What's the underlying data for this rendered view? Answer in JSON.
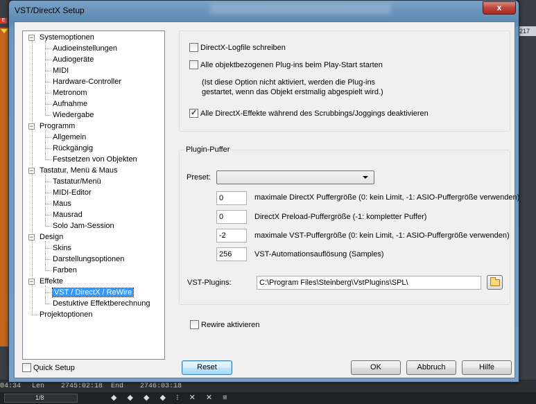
{
  "window": {
    "title": "VST/DirectX Setup",
    "close_label": "x"
  },
  "background": {
    "left_tag": "E",
    "right_ruler": "217",
    "status": {
      "pos": "04:34",
      "len_label": "Len",
      "len_value": "2745:02:18",
      "end_label": "End",
      "end_value": "2746:03:18"
    },
    "zoom": "1/8",
    "tools": "◆ ◆ ◆ ◆ ⁝ ✕ ✕ ≡"
  },
  "tree": [
    {
      "label": "Systemoptionen",
      "level": 0,
      "expander": "−"
    },
    {
      "label": "Audioeinstellungen",
      "level": 1
    },
    {
      "label": "Audiogeräte",
      "level": 1
    },
    {
      "label": "MIDI",
      "level": 1
    },
    {
      "label": "Hardware-Controller",
      "level": 1
    },
    {
      "label": "Metronom",
      "level": 1
    },
    {
      "label": "Aufnahme",
      "level": 1
    },
    {
      "label": "Wiedergabe",
      "level": 1
    },
    {
      "label": "Programm",
      "level": 0,
      "expander": "−"
    },
    {
      "label": "Allgemein",
      "level": 1
    },
    {
      "label": "Rückgängig",
      "level": 1
    },
    {
      "label": "Festsetzen von Objekten",
      "level": 1
    },
    {
      "label": "Tastatur, Menü & Maus",
      "level": 0,
      "expander": "−"
    },
    {
      "label": "Tastatur/Menü",
      "level": 1
    },
    {
      "label": "MIDI-Editor",
      "level": 1
    },
    {
      "label": "Maus",
      "level": 1
    },
    {
      "label": "Mausrad",
      "level": 1
    },
    {
      "label": "Solo Jam-Session",
      "level": 1
    },
    {
      "label": "Design",
      "level": 0,
      "expander": "−"
    },
    {
      "label": "Skins",
      "level": 1
    },
    {
      "label": "Darstellungsoptionen",
      "level": 1
    },
    {
      "label": "Farben",
      "level": 1
    },
    {
      "label": "Effekte",
      "level": 0,
      "expander": "−"
    },
    {
      "label": "VST / DirectX / ReWire",
      "level": 1,
      "selected": true
    },
    {
      "label": "Destuktive Effektberechnung",
      "level": 1
    },
    {
      "label": "Projektoptionen",
      "level": 0
    }
  ],
  "quick_setup": {
    "label": "Quick Setup",
    "checked": false
  },
  "options": {
    "directx_log": {
      "label": "DirectX-Logfile schreiben",
      "checked": false
    },
    "start_plugins": {
      "label": "Alle objektbezogenen Plug-ins beim Play-Start starten",
      "checked": false
    },
    "start_plugins_note": [
      "(Ist diese Option nicht aktiviert, werden die Plug-ins",
      "gestartet, wenn das Objekt erstmalig abgespielt wird.)"
    ],
    "disable_scrub": {
      "label": "Alle DirectX-Effekte während des Scrubbings/Joggings deaktivieren",
      "checked": true
    }
  },
  "plugin_buffer": {
    "group_title": "Plugin-Puffer",
    "preset_label": "Preset:",
    "preset_value": "",
    "fields": [
      {
        "value": "0",
        "label": "maximale DirectX Puffergröße (0: kein Limit, -1: ASIO-Puffergröße verwenden)"
      },
      {
        "value": "0",
        "label": "DirectX Preload-Puffergröße (-1: kompletter Puffer)"
      },
      {
        "value": "-2",
        "label": "maximale VST-Puffergröße (0: kein Limit, -1: ASIO-Puffergröße verwenden)"
      },
      {
        "value": "256",
        "label": "VST-Automationsauflösung (Samples)"
      }
    ],
    "vst_path_label": "VST-Plugins:",
    "vst_path_value": "C:\\Program Files\\Steinberg\\VstPlugins\\SPL\\"
  },
  "rewire": {
    "label": "Rewire aktivieren",
    "checked": false
  },
  "buttons": {
    "reset": "Reset",
    "ok": "OK",
    "cancel": "Abbruch",
    "help": "Hilfe"
  }
}
